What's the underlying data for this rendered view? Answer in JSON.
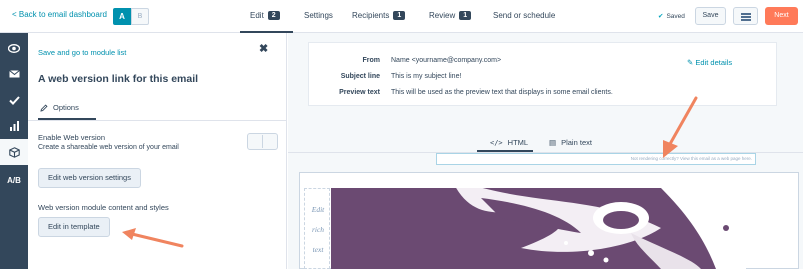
{
  "topbar": {
    "back_label": "< Back to email dashboard",
    "ab_a": "A",
    "ab_b": "B",
    "tabs": [
      {
        "label": "Edit",
        "count": "2"
      },
      {
        "label": "Settings",
        "count": ""
      },
      {
        "label": "Recipients",
        "count": "1"
      },
      {
        "label": "Review",
        "count": "1"
      },
      {
        "label": "Send or schedule",
        "count": ""
      }
    ],
    "saved_label": "Saved",
    "save_button": "Save",
    "next_button": "Next"
  },
  "rail": {
    "items": [
      "eye-icon",
      "email-icon",
      "check-icon",
      "chart-icon",
      "module-icon",
      "ab-test-icon"
    ],
    "ab_label": "A/B"
  },
  "panel": {
    "back_label": "Save and go to module list",
    "title": "A web version link for this email",
    "options_tab": "Options",
    "enable_label": "Enable Web version",
    "enable_help": "Create a shareable web version of your email",
    "edit_settings_button": "Edit web version settings",
    "module_content_label": "Web version module content and styles",
    "edit_template_button": "Edit in template"
  },
  "header": {
    "from_label": "From",
    "from_value": "Name <yourname@company.com>",
    "subject_label": "Subject line",
    "subject_value": "This is my subject line!",
    "preview_label": "Preview text",
    "preview_value": "This will be used as the preview text that displays in some email clients.",
    "edit_details": "Edit details"
  },
  "view_tabs": {
    "html_label": "HTML",
    "plain_label": "Plain text"
  },
  "weblink_text": "Not rendering correctly? View this email as a web page here.",
  "rich_text_words": [
    "Edit",
    "rich",
    "text"
  ],
  "colors": {
    "accent": "#0091ae",
    "nav_dark": "#33475b",
    "next_orange": "#ff7a59",
    "arrow_orange": "#f0845f",
    "image_purple": "#6b4a72"
  }
}
